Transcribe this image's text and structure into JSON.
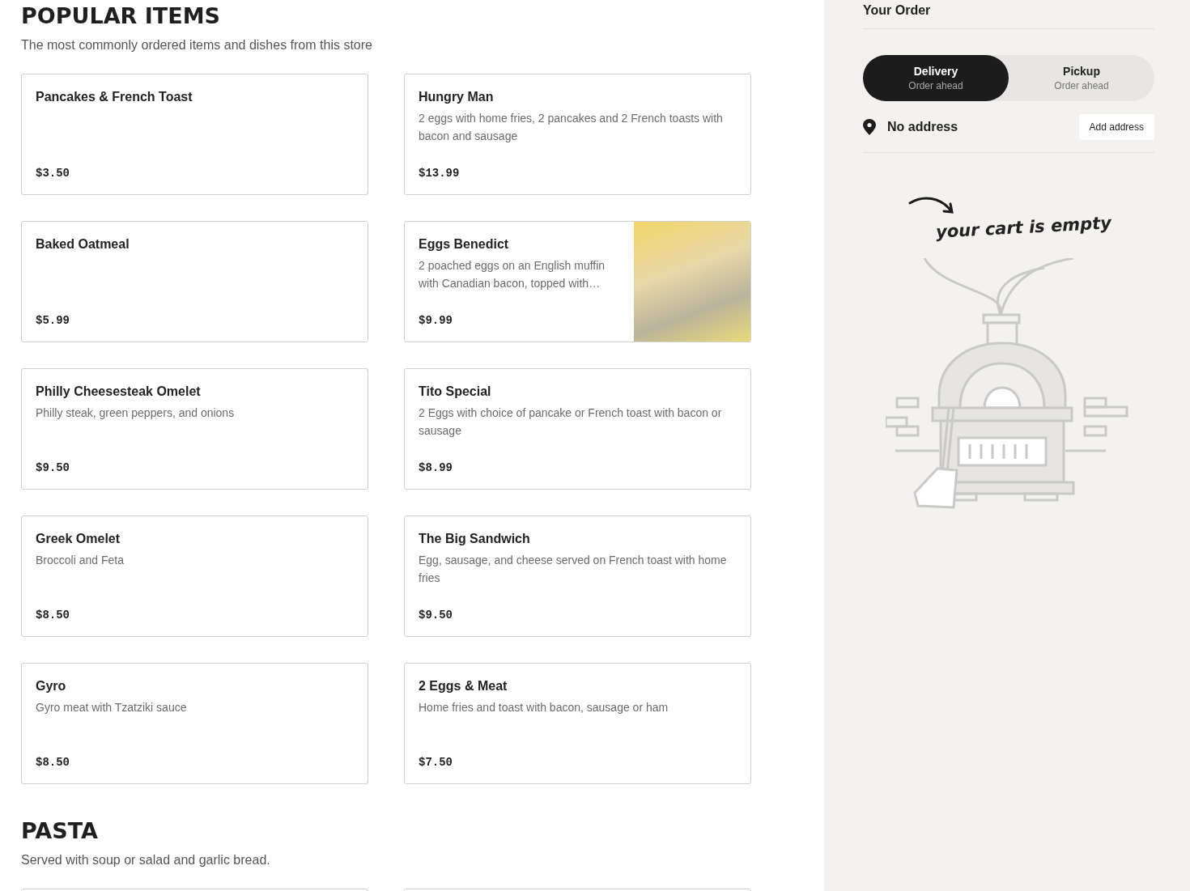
{
  "sections": [
    {
      "title": "POPULAR ITEMS",
      "subtitle": "The most commonly ordered items and dishes from this store",
      "items": [
        {
          "kind": "item",
          "name": "Pancakes & French Toast",
          "price": "$3.50"
        },
        {
          "kind": "item",
          "name": "Hungry Man",
          "description": "2 eggs with home fries, 2 pancakes and 2 French toasts with bacon and sausage",
          "price": "$13.99"
        },
        {
          "kind": "item",
          "name": "Baked Oatmeal",
          "price": "$5.99"
        },
        {
          "kind": "item",
          "name": "Eggs Benedict",
          "description": "2 poached eggs on an English muffin with Canadian bacon, topped with…",
          "price": "$9.99",
          "photo": true
        },
        {
          "kind": "item",
          "name": "Philly Cheesesteak Omelet",
          "description": "Philly steak, green peppers, and onions",
          "price": "$9.50"
        },
        {
          "kind": "item",
          "name": "Tito Special",
          "description": "2 Eggs with choice of pancake or French toast with bacon or sausage",
          "price": "$8.99"
        },
        {
          "kind": "item",
          "name": "Greek Omelet",
          "description": "Broccoli and Feta",
          "price": "$8.50"
        },
        {
          "kind": "item",
          "name": "The Big Sandwich",
          "description": "Egg, sausage, and cheese served on French toast with home fries",
          "price": "$9.50"
        },
        {
          "kind": "item",
          "name": "Gyro",
          "description": "Gyro meat with Tzatziki sauce",
          "price": "$8.50"
        },
        {
          "kind": "item",
          "name": "2 Eggs & Meat",
          "description": "Home fries and toast with bacon, sausage or ham",
          "price": "$7.50"
        }
      ]
    },
    {
      "title": "PASTA",
      "subtitle": "Served with soup or salad and garlic bread.",
      "items": [
        {
          "kind": "partial"
        },
        {
          "kind": "partial"
        }
      ]
    }
  ],
  "order": {
    "title": "Your Order",
    "modes": [
      {
        "label": "Delivery",
        "sublabel": "Order ahead",
        "selected": true
      },
      {
        "label": "Pickup",
        "sublabel": "Order ahead",
        "selected": false
      }
    ],
    "address": "No address",
    "address_button": "Add address",
    "empty_message": "your cart is empty"
  }
}
